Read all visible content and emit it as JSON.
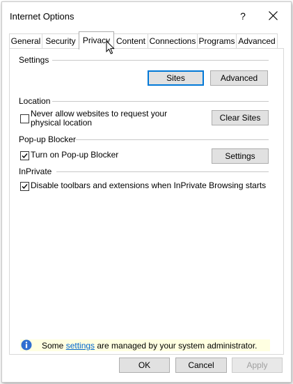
{
  "window": {
    "title": "Internet Options",
    "help_label": "?"
  },
  "tabs": [
    {
      "label": "General"
    },
    {
      "label": "Security"
    },
    {
      "label": "Privacy"
    },
    {
      "label": "Content"
    },
    {
      "label": "Connections"
    },
    {
      "label": "Programs"
    },
    {
      "label": "Advanced"
    }
  ],
  "active_tab": "Privacy",
  "settings": {
    "heading": "Settings",
    "sites_label": "Sites",
    "advanced_label": "Advanced"
  },
  "location": {
    "heading": "Location",
    "never_allow_line1": "Never allow websites to request your",
    "never_allow_line2": "physical location",
    "never_allow_checked": false,
    "clear_sites_label": "Clear Sites"
  },
  "popup": {
    "heading": "Pop-up Blocker",
    "turn_on_label": "Turn on Pop-up Blocker",
    "turn_on_checked": true,
    "settings_label": "Settings"
  },
  "inprivate": {
    "heading": "InPrivate",
    "disable_label": "Disable toolbars and extensions when InPrivate Browsing starts",
    "disable_checked": true
  },
  "info": {
    "prefix": "Some ",
    "link": "settings",
    "suffix": " are managed by your system administrator."
  },
  "footer": {
    "ok_label": "OK",
    "cancel_label": "Cancel",
    "apply_label": "Apply"
  },
  "colors": {
    "accent": "#0078d7",
    "info_bg": "#ffffe1",
    "link": "#0066cc"
  }
}
